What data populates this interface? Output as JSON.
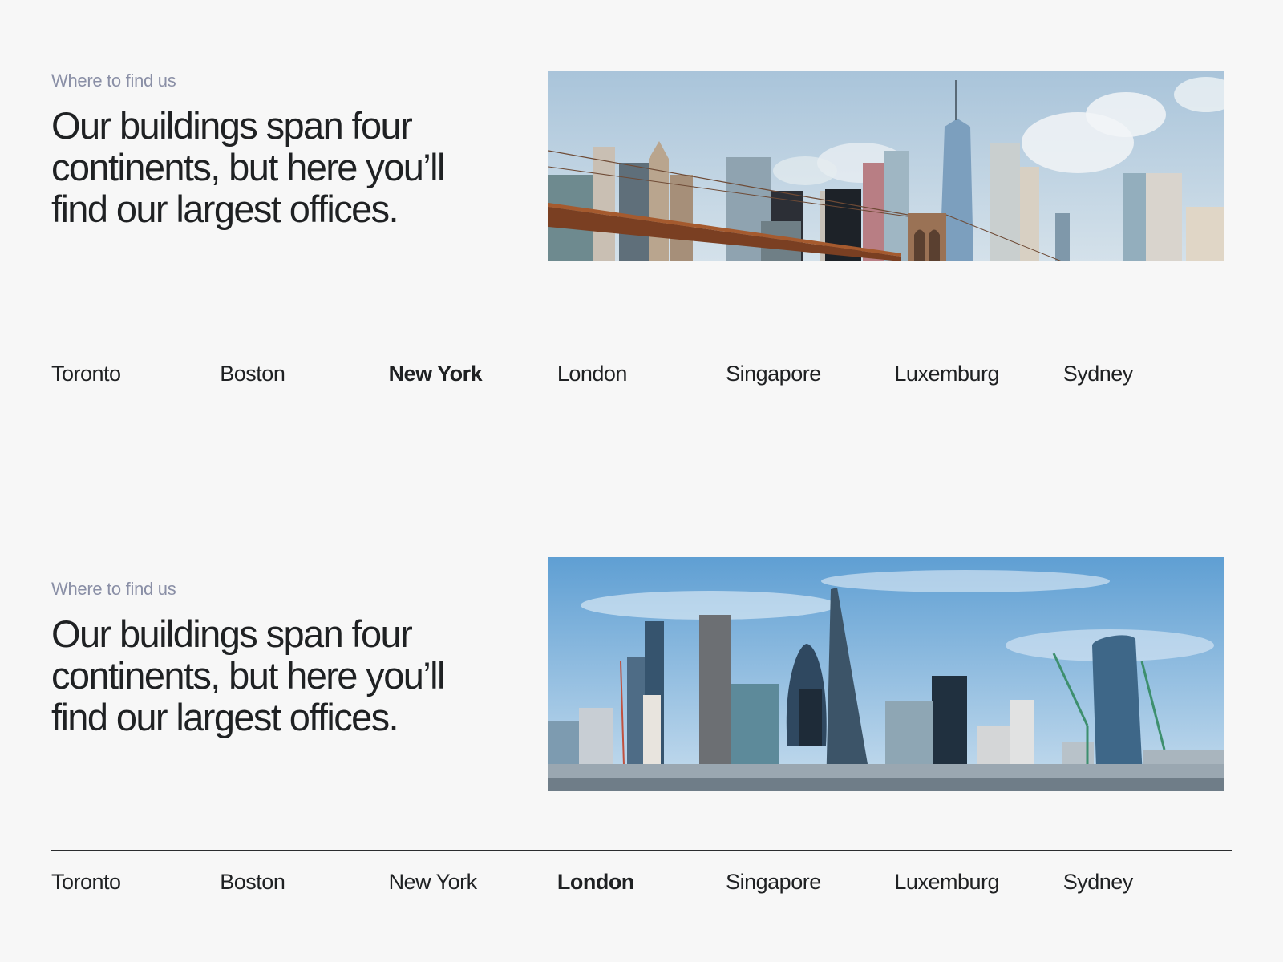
{
  "sections": [
    {
      "eyebrow": "Where to find us",
      "headline": "Our buildings span four continents, but here you’ll find our largest offices.",
      "image_alt": "New York skyline with bridge",
      "active_city": "New York",
      "cities": [
        "Toronto",
        "Boston",
        "New York",
        "London",
        "Singapore",
        "Luxemburg",
        "Sydney"
      ]
    },
    {
      "eyebrow": "Where to find us",
      "headline": "Our buildings span four continents, but here you’ll find our largest offices.",
      "image_alt": "London skyline",
      "active_city": "London",
      "cities": [
        "Toronto",
        "Boston",
        "New York",
        "London",
        "Singapore",
        "Luxemburg",
        "Sydney"
      ]
    }
  ],
  "colors": {
    "background": "#f7f7f7",
    "text": "#1f2123",
    "eyebrow": "#8a8fa6",
    "divider": "#2a2c2e",
    "sky_ny": "#b8cfe0",
    "sky_london": "#7fb1d9"
  }
}
